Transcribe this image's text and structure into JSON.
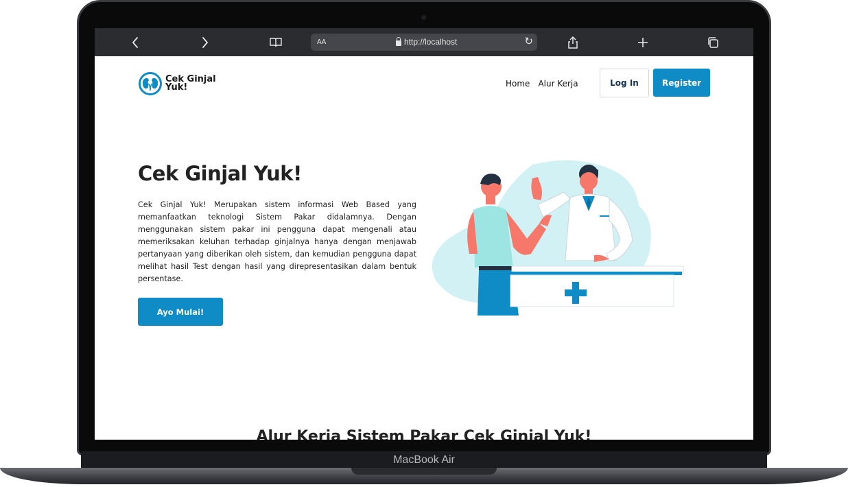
{
  "device": {
    "label": "MacBook Air"
  },
  "browser": {
    "text_size_label": "AA",
    "url": "http://localhost"
  },
  "site": {
    "logo_line1": "Cek Ginjal",
    "logo_line2": "Yuk!",
    "nav": [
      {
        "label": "Home"
      },
      {
        "label": "Alur Kerja"
      }
    ],
    "login_label": "Log In",
    "register_label": "Register"
  },
  "hero": {
    "title": "Cek Ginjal Yuk!",
    "description": "Cek Ginjal Yuk! Merupakan sistem informasi Web Based yang memanfaatkan teknologi Sistem Pakar didalamnya. Dengan menggunakan sistem pakar ini pengguna dapat mengenali atau memeriksakan keluhan terhadap ginjalnya hanya dengan menjawab pertanyaan yang diberikan oleh sistem, dan kemudian pengguna dapat melihat hasil Test dengan hasil yang direpresentasikan dalam bentuk persentase.",
    "cta_label": "Ayo Mulai!"
  },
  "section": {
    "title": "Alur Kerja Sistem Pakar Cek Ginjal Yuk!"
  },
  "colors": {
    "brand": "#0f8bc6",
    "illustration_bg": "#d1f1f4",
    "browser_bar": "#2b2c30"
  }
}
